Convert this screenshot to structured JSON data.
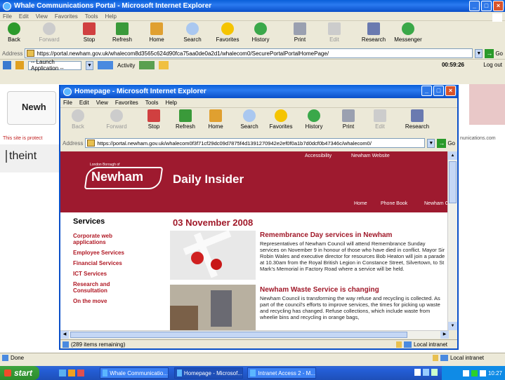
{
  "outer": {
    "title": "Whale Communications Portal - Microsoft Internet Explorer",
    "menu": [
      "File",
      "Edit",
      "View",
      "Favorites",
      "Tools",
      "Help"
    ],
    "toolbar": [
      "Back",
      "Forward",
      "Stop",
      "Refresh",
      "Home",
      "Search",
      "Favorites",
      "History",
      "Print",
      "Edit",
      "Research",
      "Messenger"
    ],
    "address_label": "Address",
    "address_url": "https://portal.newham.gov.uk/whalecom8d3565c624d90fca75aa0de0a2d1/whalecom0/SecurePortalPortalHomePage/",
    "go_label": "Go",
    "portal_toolbar": {
      "launch": "-- Launch Application --",
      "activity": "Activity",
      "timer": "00:59:26",
      "logout": "Log out"
    },
    "bg_left": {
      "brand": "Newh",
      "notice": "This site is protect",
      "footer_brand": "theint"
    },
    "bg_right": {
      "text": "nunications.com"
    },
    "status": "Done",
    "zone": "Local intranet"
  },
  "inner": {
    "title": "Homepage - Microsoft Internet Explorer",
    "menu": [
      "File",
      "Edit",
      "View",
      "Favorites",
      "Tools",
      "Help"
    ],
    "toolbar": [
      "Back",
      "Forward",
      "Stop",
      "Refresh",
      "Home",
      "Search",
      "Favorites",
      "History",
      "Print",
      "Edit",
      "Research"
    ],
    "address_label": "Address",
    "address_url": "https://portal.newham.gov.uk/whalecom0f3f71cf29dc09d7875f4d1391270942e2ef0f0a1b7d0dcf0b47346c/whalecom0/",
    "go_label": "Go",
    "status": "(289 items remaining)",
    "zone": "Local intranet",
    "page": {
      "top_links": [
        "Accessibility",
        "Newham Website"
      ],
      "logo": "Newham",
      "logo_sub": "London Borough of",
      "site_title": "Daily Insider",
      "nav": [
        "Home",
        "Phone Book",
        "Newham C"
      ],
      "services_title": "Services",
      "services": [
        "Corporate web applications",
        "Employee Services",
        "Financial Services",
        "ICT Services",
        "Research and Consultation",
        "On the move"
      ],
      "date": "03 November 2008",
      "articles": [
        {
          "title": "Remembrance Day services in Newham",
          "body": "Representatives of Newham Council will attend Remembrance Sunday services on November 9 in honour of those who have died in conflict. Mayor Sir Robin Wales and executive director for resources Bob Heaton will join a parade at 10.30am from the Royal British Legion in Constance Street, Silvertown, to St Mark's Memorial in Factory Road where a service will be held."
        },
        {
          "title": "Newham Waste Service is changing",
          "body": "Newham Council is transforming the way refuse and recycling is collected. As part of the council's efforts to improve services, the times for picking up waste and recycling has changed. Refuse collections, which include waste from wheelie bins and recycling in orange bags,"
        }
      ]
    }
  },
  "taskbar": {
    "start": "start",
    "tasks": [
      "Whale Communicatio...",
      "Homepage - Microsof...",
      "Intranet Access 2 - M..."
    ],
    "clock": "10:27"
  },
  "colors": {
    "newham_red": "#9e1a2f",
    "xp_blue": "#0a5fd8"
  }
}
